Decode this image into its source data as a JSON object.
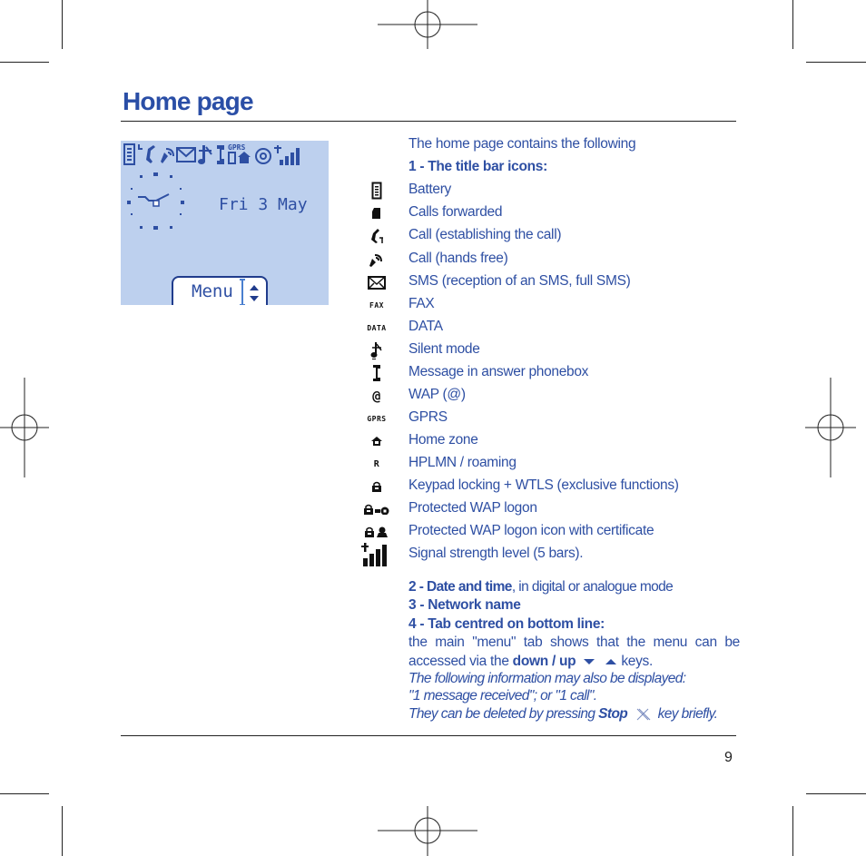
{
  "page": {
    "title": "Home page",
    "page_number": "9"
  },
  "screen": {
    "status_icons": [
      "battery-icon",
      "calls-forwarded-icon",
      "call-establishing-icon",
      "hands-free-icon",
      "sms-icon",
      "silent-mode-icon",
      "answer-phonebox-icon",
      "gprs-home-zone-icon",
      "wap-icon",
      "signal-strength-icon"
    ],
    "date": "Fri 3 May",
    "tab_label": "Menu",
    "background_color": "#bdd0ee",
    "pixel_color": "#2e4fa3"
  },
  "content": {
    "intro": "The home page contains the following",
    "section1_heading": "1 - The title bar icons:",
    "icons": [
      {
        "icon": "battery-icon",
        "label": "Battery"
      },
      {
        "icon": "calls-forwarded-icon",
        "label": "Calls forwarded"
      },
      {
        "icon": "call-establishing-icon",
        "label": "Call (establishing the call)"
      },
      {
        "icon": "hands-free-icon",
        "label": "Call (hands free)"
      },
      {
        "icon": "sms-icon",
        "label": "SMS (reception of an SMS, full SMS)"
      },
      {
        "icon": "fax-icon",
        "icon_text": "FAX",
        "label": "FAX"
      },
      {
        "icon": "data-icon",
        "icon_text": "DATA",
        "label": "DATA"
      },
      {
        "icon": "silent-mode-icon",
        "label": "Silent mode"
      },
      {
        "icon": "answer-phonebox-icon",
        "label": "Message in answer phonebox"
      },
      {
        "icon": "wap-icon",
        "icon_text": "@",
        "label": "WAP (@)"
      },
      {
        "icon": "gprs-icon",
        "icon_text": "GPRS",
        "label": "GPRS"
      },
      {
        "icon": "home-zone-icon",
        "label": "Home zone"
      },
      {
        "icon": "roaming-icon",
        "icon_text": "R",
        "label": "HPLMN / roaming"
      },
      {
        "icon": "keypad-lock-icon",
        "label": "Keypad locking + WTLS (exclusive functions)"
      },
      {
        "icon": "protected-wap-icon",
        "label": "Protected WAP logon"
      },
      {
        "icon": "protected-wap-certificate-icon",
        "label": "Protected WAP logon icon with certificate"
      },
      {
        "icon": "signal-strength-icon",
        "label": "Signal strength level (5 bars)."
      }
    ],
    "section2_heading": "2 - Date and time",
    "section2_text": ", in digital or analogue mode",
    "section3_heading": "3 - Network name",
    "section4_heading": "4 - Tab centred on bottom line:",
    "section4_line1": "the main \"menu\" tab shows that the menu can be",
    "section4_line2_pre": "accessed via the ",
    "section4_line2_bold": "down / up",
    "section4_line2_post": " keys.",
    "note_line1": "The following information may also be displayed:",
    "note_line2": "\"1 message received\"; or \"1 call\".",
    "note_line3_pre": "They can be deleted by pressing ",
    "note_line3_bold": "Stop",
    "note_line3_post": " key briefly."
  },
  "colors": {
    "text_blue": "#2e4fa3",
    "title_blue": "#2a4ea6",
    "screen_bg": "#bdd0ee"
  }
}
